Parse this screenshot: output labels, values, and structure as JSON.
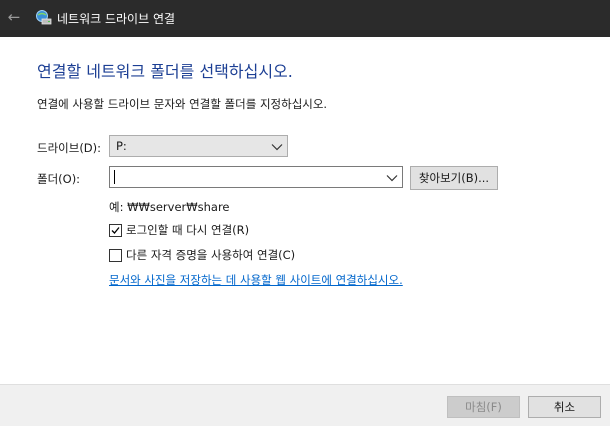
{
  "window": {
    "title": "네트워크 드라이브 연결",
    "back_icon": "back-arrow-icon",
    "app_icon": "network-drive-icon"
  },
  "main": {
    "heading": "연결할 네트워크 폴더를 선택하십시오.",
    "description": "연결에 사용할 드라이브 문자와 연결할 폴더를 지정하십시오.",
    "drive_label": "드라이브(D):",
    "drive_value": "P:",
    "folder_label": "폴더(O):",
    "folder_value": "",
    "browse_label": "찾아보기(B)...",
    "example": "예: ₩₩server₩share",
    "reconnect_label": "로그인할 때 다시 연결(R)",
    "reconnect_checked": true,
    "other_credentials_label": "다른 자격 증명을 사용하여 연결(C)",
    "other_credentials_checked": false,
    "link_text": "문서와 사진을 저장하는 데 사용할 웹 사이트에 연결하십시오."
  },
  "footer": {
    "finish_label": "마침(F)",
    "cancel_label": "취소"
  },
  "colors": {
    "titlebar": "#2b2b2b",
    "heading": "#1c3f94",
    "link": "#0066cc"
  }
}
